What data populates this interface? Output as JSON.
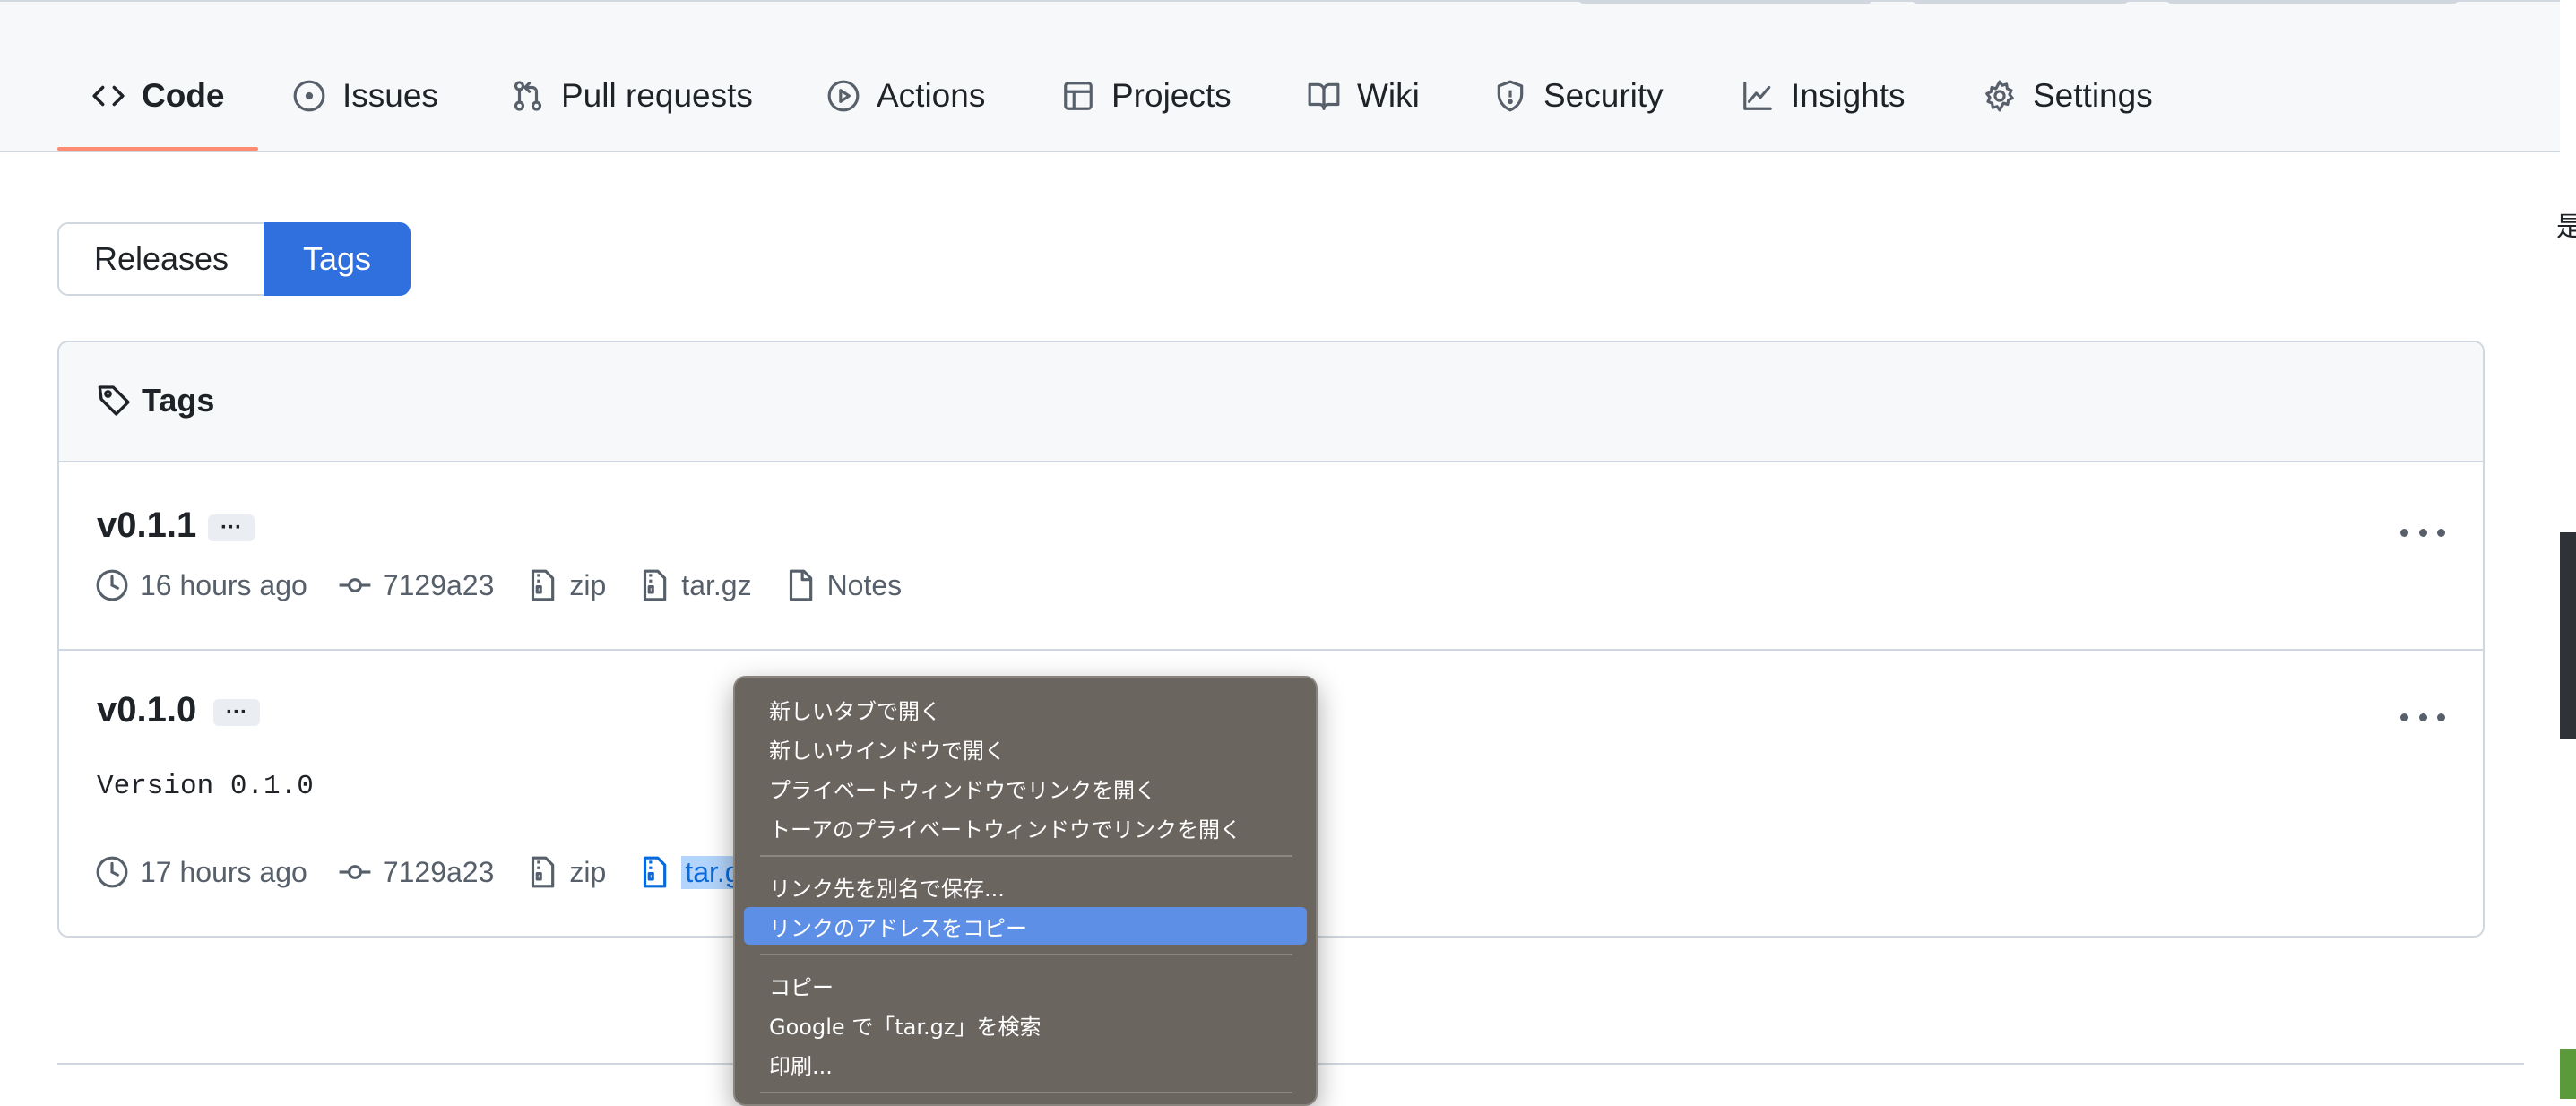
{
  "nav": {
    "tabs": [
      {
        "label": "Code",
        "icon": "code-icon",
        "selected": true
      },
      {
        "label": "Issues",
        "icon": "issue-opened-icon"
      },
      {
        "label": "Pull requests",
        "icon": "git-pull-request-icon"
      },
      {
        "label": "Actions",
        "icon": "play-icon"
      },
      {
        "label": "Projects",
        "icon": "table-icon"
      },
      {
        "label": "Wiki",
        "icon": "book-icon"
      },
      {
        "label": "Security",
        "icon": "shield-icon"
      },
      {
        "label": "Insights",
        "icon": "graph-icon"
      },
      {
        "label": "Settings",
        "icon": "gear-icon"
      }
    ],
    "accent_color": "#fd8c73"
  },
  "segmented": {
    "releases": "Releases",
    "tags": "Tags",
    "selected": "Tags",
    "selected_color": "#2f6fde"
  },
  "tags_box": {
    "header": "Tags",
    "rows": [
      {
        "name": "v0.1.1",
        "ellipsis": "···",
        "time": "16 hours ago",
        "commit": "7129a23",
        "zip": "zip",
        "targz": "tar.gz",
        "notes": "Notes"
      },
      {
        "name": "v0.1.0",
        "ellipsis": "···",
        "message": "Version 0.1.0",
        "time": "17 hours ago",
        "commit": "7129a23",
        "zip": "zip",
        "targz": "tar.gz"
      }
    ]
  },
  "context_menu": {
    "items": [
      "新しいタブで開く",
      "新しいウインドウで開く",
      "プライベートウィンドウでリンクを開く",
      "トーアのプライベートウィンドウでリンクを開く",
      "リンク先を別名で保存...",
      "リンクのアドレスをコピー",
      "コピー",
      "Google で「tar.gz」を検索",
      "印刷..."
    ],
    "active_item": "リンクのアドレスをコピー",
    "highlight_color": "#5d8fe6"
  },
  "edge_glyph": "是"
}
